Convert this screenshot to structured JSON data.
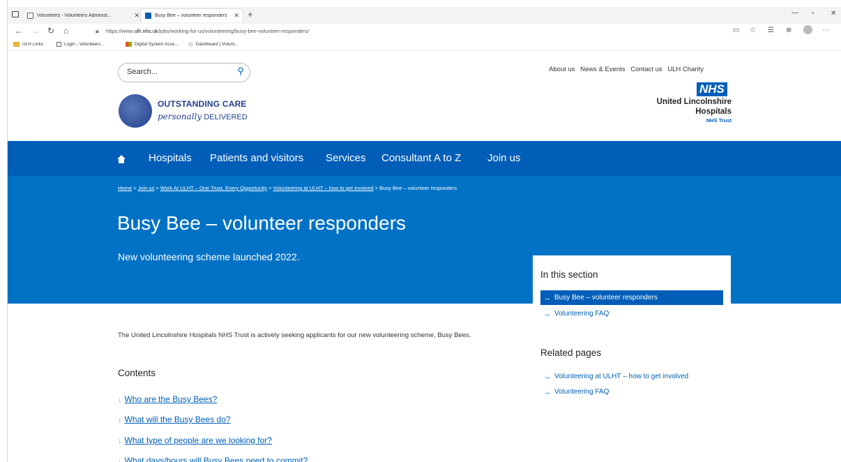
{
  "browser": {
    "tabs": [
      {
        "title": "Volunteers - Volunteers Administ...",
        "active": false
      },
      {
        "title": "Busy Bee – volunteer responders",
        "active": true
      }
    ],
    "url_prefix": "https://www.",
    "url_domain": "ulh.nhs.uk",
    "url_path": "/jobs/working-for-us/volunteering/busy-bee-volunteer-responders/",
    "bookmarks": [
      "ULH Links",
      "Login - Volunteers...",
      "Digital System Acce...",
      "Dashboard | Volunt..."
    ]
  },
  "header": {
    "search_placeholder": "Search...",
    "top_links": [
      "About us",
      "News & Events",
      "Contact us",
      "ULH Charity"
    ],
    "logo_line1": "OUTSTANDING CARE",
    "logo_line2_italic": "personally",
    "logo_line2_bold": "DELIVERED",
    "nhs_badge": "NHS",
    "org_line1": "United Lincolnshire",
    "org_line2": "Hospitals",
    "org_line3": "NHS Trust"
  },
  "nav": {
    "items": [
      "Hospitals",
      "Patients and visitors",
      "Services",
      "Consultant A to Z",
      "Join us"
    ]
  },
  "hero": {
    "breadcrumb": [
      "Home",
      "Join us",
      "Work At ULHT – One Trust, Every Opportunity",
      "Volunteering at ULHT – how to get involved"
    ],
    "breadcrumb_current": "Busy Bee – volunteer responders",
    "title": "Busy Bee – volunteer responders",
    "lead": "New volunteering scheme launched 2022."
  },
  "sidebar": {
    "section_title": "In this section",
    "section_links": [
      "Busy Bee – volunteer responders",
      "Volunteering FAQ"
    ],
    "related_title": "Related pages",
    "related_links": [
      "Volunteering at ULHT – how to get involved",
      "Volunteering FAQ"
    ]
  },
  "main": {
    "intro": "The United Lincolnshire Hospitals NHS Trust is actively seeking applicants for our new volunteering scheme, Busy Bees.",
    "contents_title": "Contents",
    "toc": [
      "Who are the Busy Bees?",
      "What will the Busy Bees do?",
      "What type of people are we looking for?",
      "What days/hours will Busy Bees need to commit?"
    ]
  },
  "colors": {
    "nhs_blue": "#005eb8",
    "hero_blue": "#0072c6"
  }
}
